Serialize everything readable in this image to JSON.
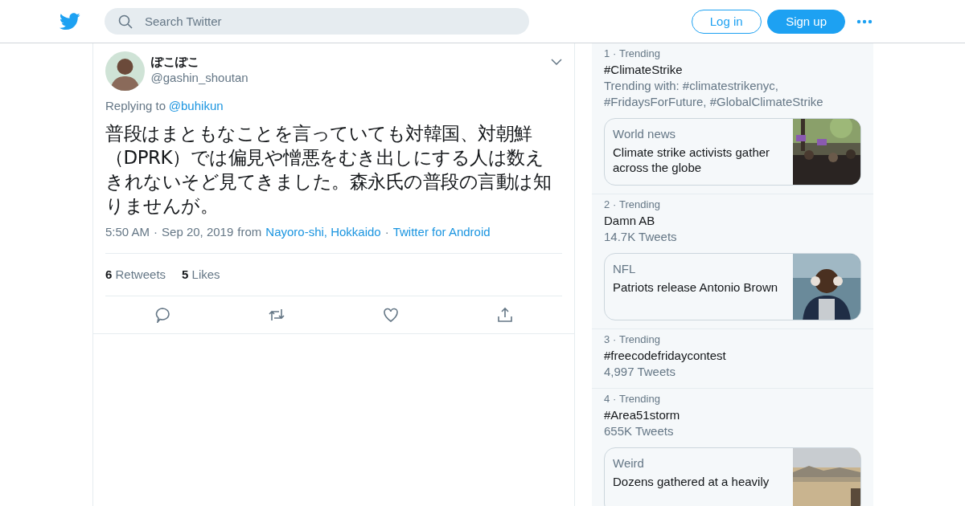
{
  "header": {
    "search": {
      "placeholder": "Search Twitter"
    },
    "buttons": [
      {
        "label": "Log in",
        "kind": "outline"
      },
      {
        "label": "Sign up",
        "kind": "solid"
      }
    ]
  },
  "tweet": {
    "display_name": "ぽこぽこ",
    "handle": "@gashin_shoutan",
    "replying_label": "Replying to",
    "replying_to": "@buhikun",
    "text": "普段はまともなことを言っていても対韓国、対朝鮮（DPRK）では偏見や憎悪をむき出しにする人は数えきれないそど見てきました。森永氏の普段の言動は知りませんが。",
    "separator": "·",
    "time": "5:50 AM",
    "date": "Sep 20, 2019",
    "from_label": "from",
    "location": "Nayoro-shi, Hokkaido",
    "source": "Twitter for Android",
    "stats": [
      {
        "count": "6",
        "label": "Retweets"
      },
      {
        "count": "5",
        "label": "Likes"
      }
    ],
    "actions": [
      {
        "kind": "reply"
      },
      {
        "kind": "retweet"
      },
      {
        "kind": "like"
      },
      {
        "kind": "share"
      }
    ]
  },
  "trends": [
    {
      "rank": "1",
      "separator": "·",
      "label": "Trending",
      "title": "#ClimateStrike",
      "subtitle": "Trending with: #climatestrikenyc, #FridaysForFuture, #GlobalClimateStrike",
      "card": {
        "category": "World news",
        "headline": "Climate strike activists gather across the globe"
      }
    },
    {
      "rank": "2",
      "separator": "·",
      "label": "Trending",
      "title": "Damn AB",
      "subtitle": "14.7K Tweets",
      "card": {
        "category": "NFL",
        "headline": "Patriots release Antonio Brown"
      }
    },
    {
      "rank": "3",
      "separator": "·",
      "label": "Trending",
      "title": "#freecodefridaycontest",
      "subtitle": "4,997 Tweets"
    },
    {
      "rank": "4",
      "separator": "·",
      "label": "Trending",
      "title": "#Area51storm",
      "subtitle": "655K Tweets",
      "card": {
        "category": "Weird",
        "headline": "Dozens gathered at a heavily"
      }
    }
  ]
}
